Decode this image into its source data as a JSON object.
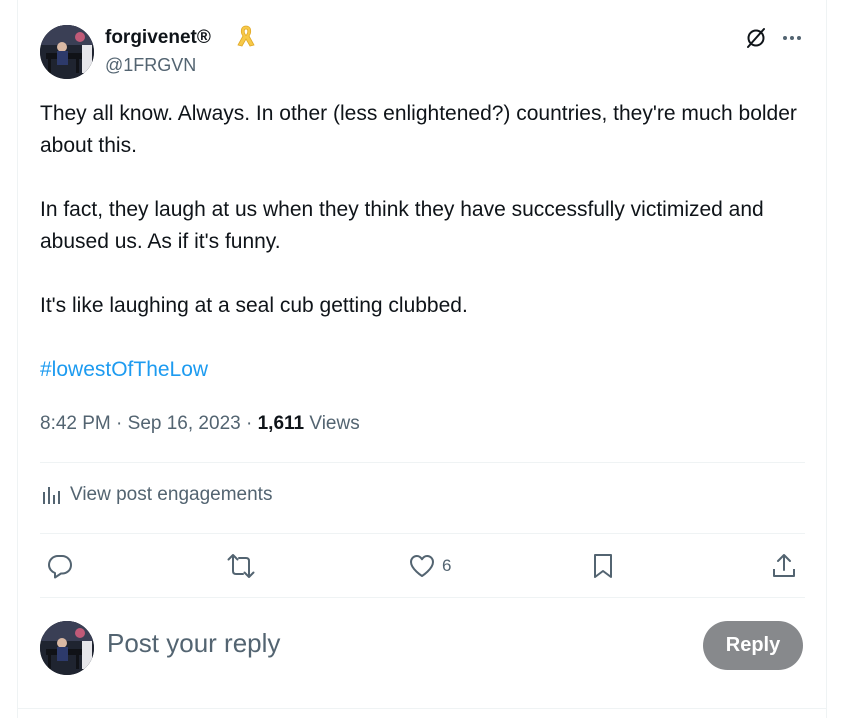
{
  "author": {
    "display_name": "forgivenet®",
    "handle": "@1FRGVN",
    "badge_icon": "awareness-ribbon-icon",
    "badge_color": "#f7c948"
  },
  "post": {
    "paragraphs": [
      "They all know. Always. In other (less enlightened?) countries, they're much bolder about this.",
      "In fact, they laugh at us when they think they have successfully victimized and abused us. As if it's funny.",
      "It's like laughing at a seal cub getting clubbed."
    ],
    "hashtag": "#lowestOfTheLow",
    "time": "8:42 PM",
    "date": "Sep 16, 2023",
    "views_count": "1,611",
    "views_label": "Views"
  },
  "engagements_label": "View post engagements",
  "actions": {
    "reply_icon": "reply-bubble-icon",
    "repost_icon": "repost-icon",
    "like_icon": "heart-icon",
    "like_count": "6",
    "bookmark_icon": "bookmark-icon",
    "share_icon": "share-icon"
  },
  "reply_box": {
    "placeholder": "Post your reply",
    "button_label": "Reply"
  },
  "colors": {
    "text": "#0f1419",
    "secondary": "#536471",
    "link": "#1d9bf0",
    "divider": "#eff3f4",
    "button_disabled": "#87898c"
  }
}
